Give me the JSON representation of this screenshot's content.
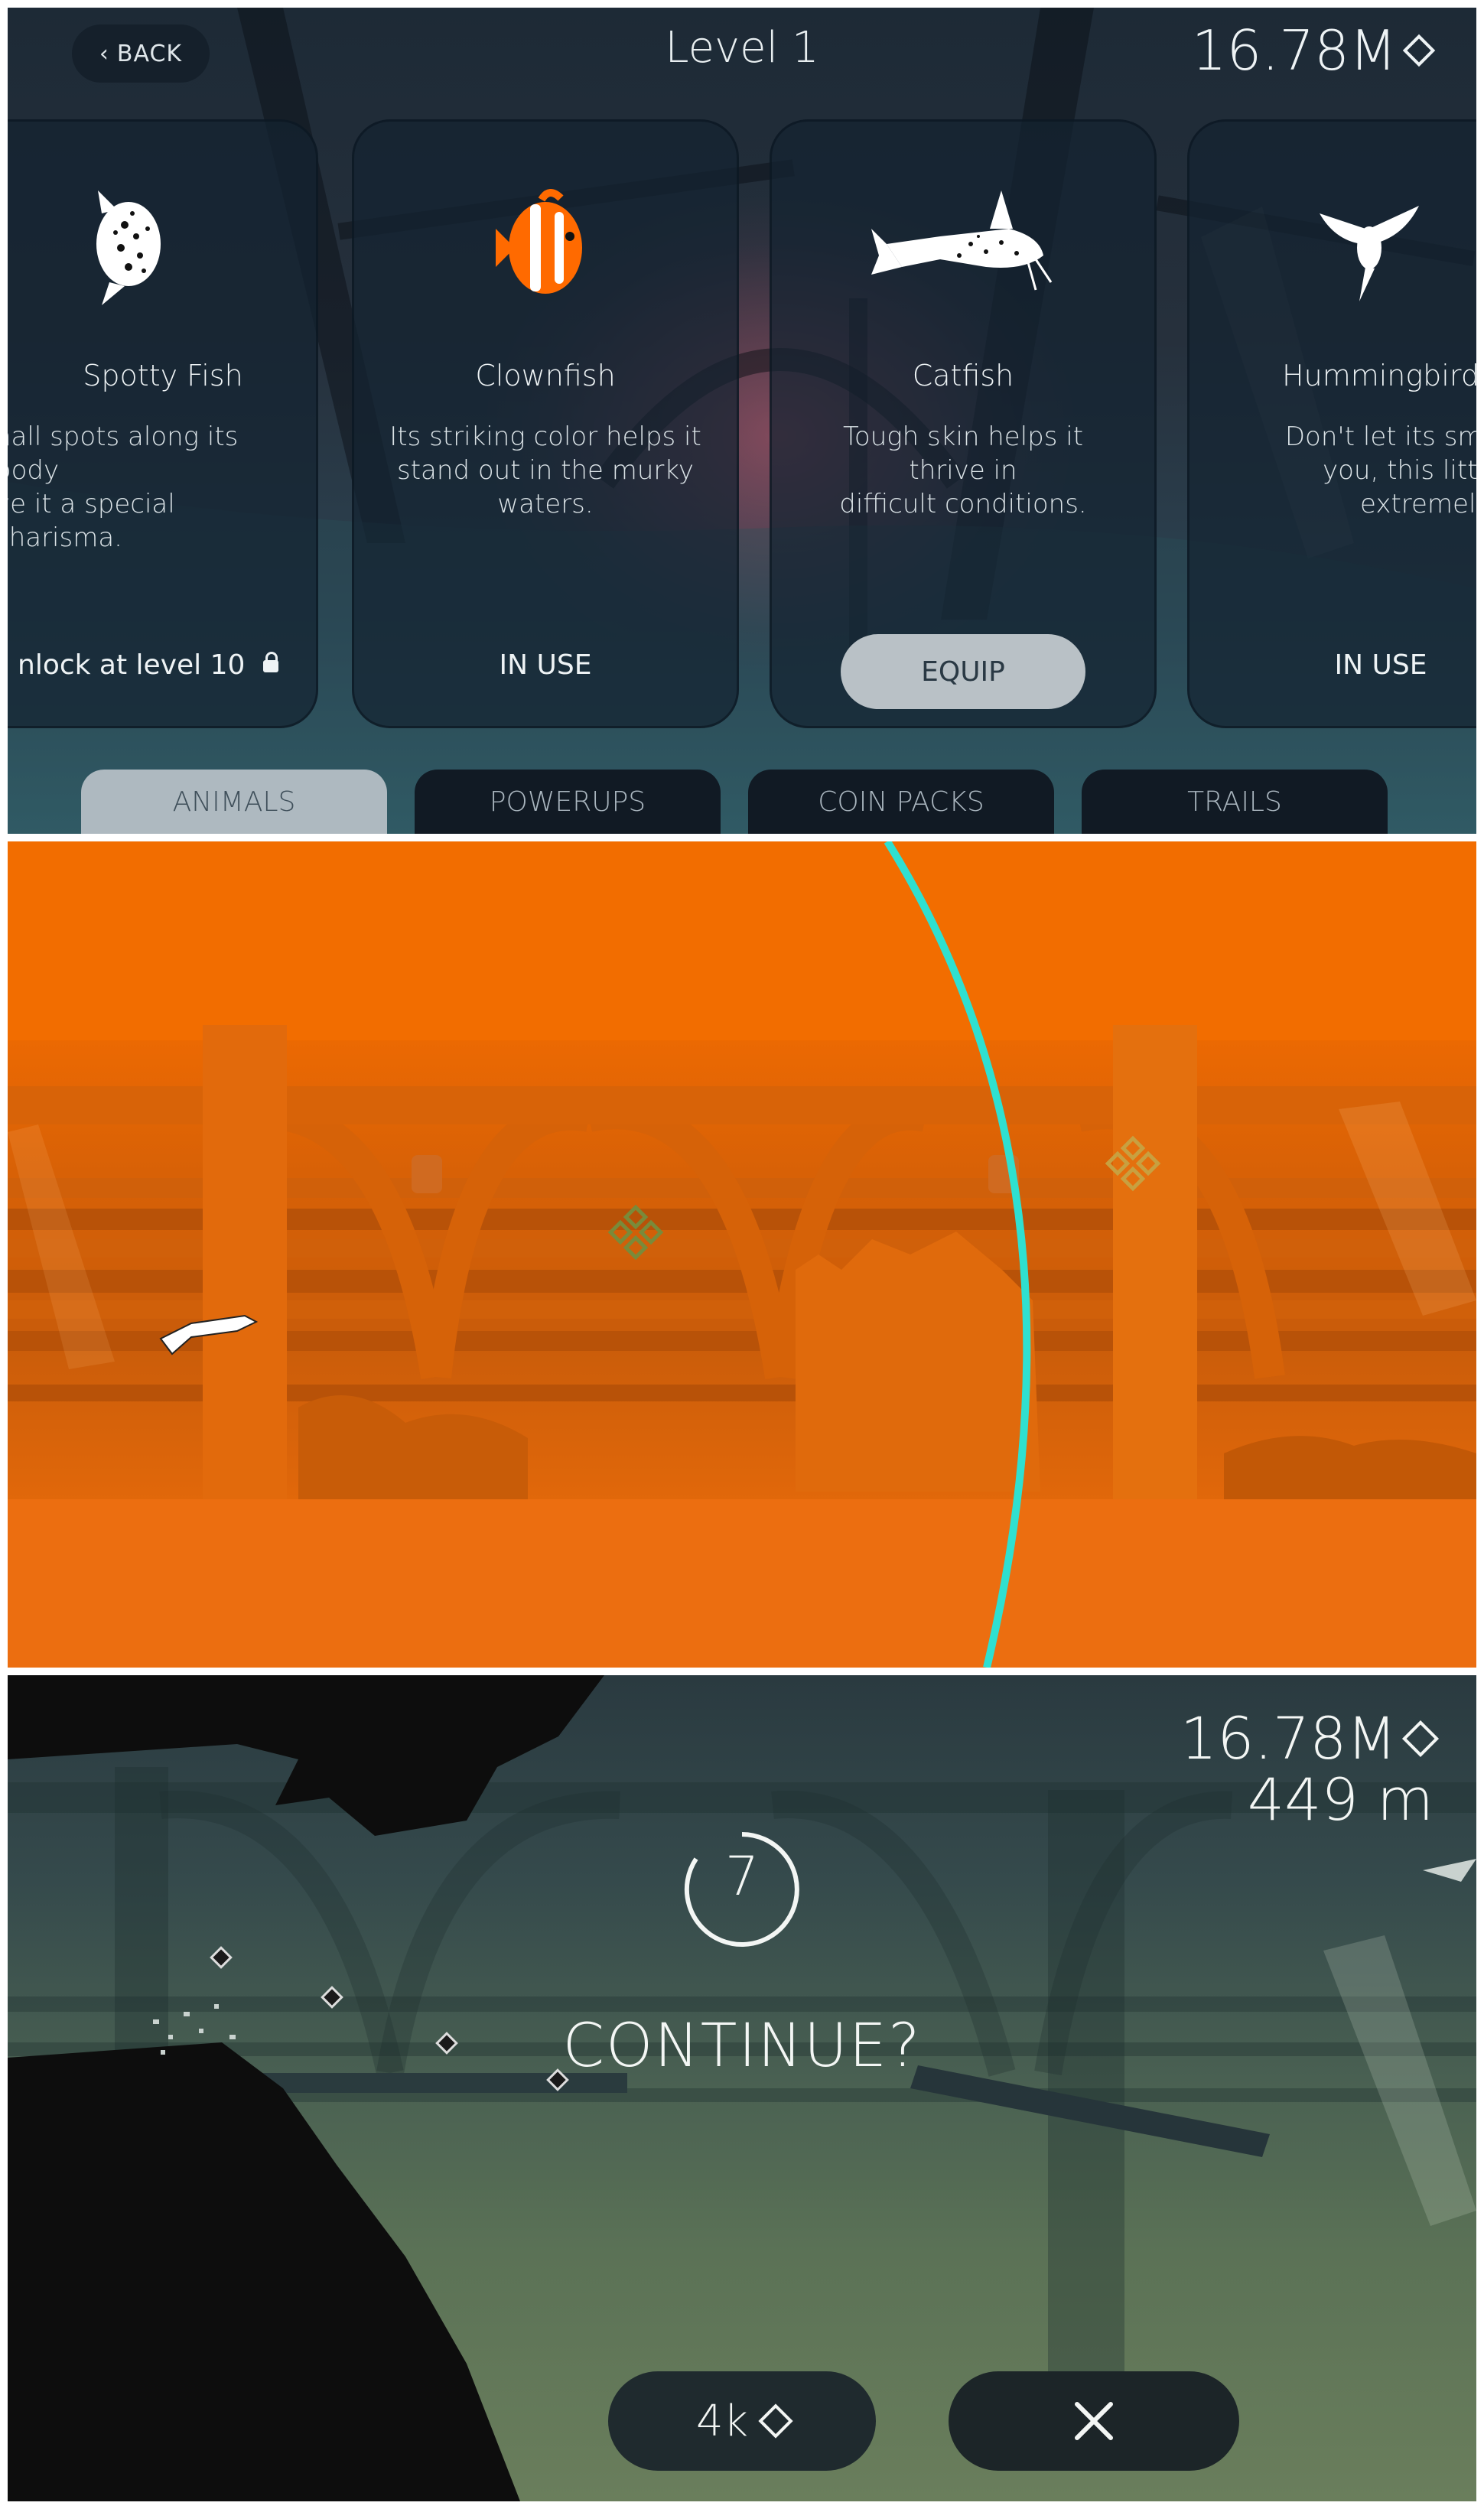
{
  "shop": {
    "back_label": "BACK",
    "level_title": "Level 1",
    "coins": "16.78M",
    "cards": [
      {
        "name": "Spotty Fish",
        "desc_line1": "nall spots along its body",
        "desc_line2": "ve it a special charisma.",
        "desc_line3": "",
        "status": "nlock at level 10",
        "icon": "spotty-fish-icon"
      },
      {
        "name": "Clownfish",
        "desc_line1": "Its striking color helps it",
        "desc_line2": "stand out in the murky",
        "desc_line3": "waters.",
        "status": "IN USE",
        "icon": "clownfish-icon"
      },
      {
        "name": "Catfish",
        "desc_line1": "Tough skin helps it thrive in",
        "desc_line2": "difficult conditions.",
        "desc_line3": "",
        "button": "EQUIP",
        "icon": "catfish-icon"
      },
      {
        "name": "Hummingbird",
        "desc_line1": "Don't let its small size",
        "desc_line2": "you, this little guy i",
        "desc_line3": "extremely fast.",
        "status": "IN USE",
        "icon": "hummingbird-icon"
      }
    ],
    "tabs": [
      "ANIMALS",
      "POWERUPS",
      "COIN PACKS",
      "TRAILS"
    ],
    "active_tab": "ANIMALS"
  },
  "orange_scene": {
    "accent_color": "#f06b00",
    "trail_color": "#2fe0d0"
  },
  "continue_screen": {
    "coins": "16.78M",
    "distance": "449 m",
    "countdown": "7",
    "prompt": "CONTINUE?",
    "pay_label": "4k",
    "close_icon": "close-icon"
  }
}
